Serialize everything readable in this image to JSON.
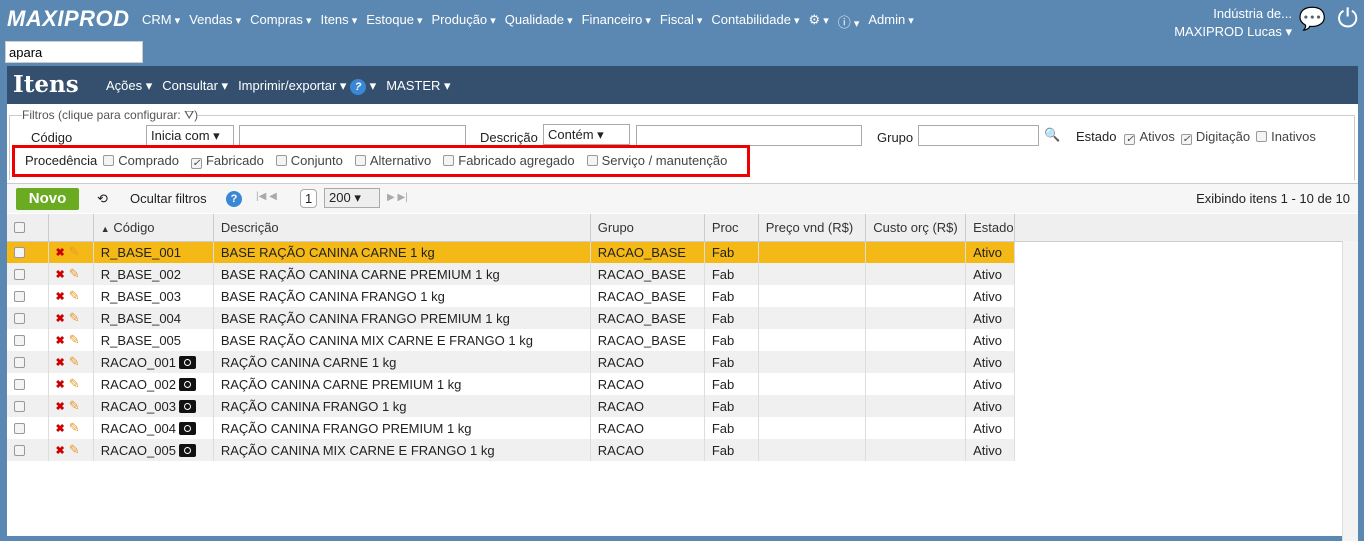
{
  "app": {
    "logo": "MAXIPROD",
    "menu": [
      "CRM",
      "Vendas",
      "Compras",
      "Itens",
      "Estoque",
      "Produção",
      "Qualidade",
      "Financeiro",
      "Fiscal",
      "Contabilidade"
    ],
    "admin": "Admin",
    "search_value": "apara",
    "company": "Indústria de...",
    "user": "MAXIPROD Lucas"
  },
  "page": {
    "title": "Itens",
    "menu": [
      "Ações",
      "Consultar",
      "Imprimir/exportar"
    ],
    "master": "MASTER"
  },
  "filters": {
    "legend": "Filtros (clique para configurar:",
    "codigo_label": "Código",
    "codigo_mode": "Inicia com",
    "descricao_label": "Descrição",
    "descricao_mode": "Contém",
    "grupo_label": "Grupo",
    "estado_label": "Estado",
    "estado": [
      {
        "label": "Ativos",
        "checked": true
      },
      {
        "label": "Digitação",
        "checked": true
      },
      {
        "label": "Inativos",
        "checked": false
      }
    ],
    "procedencia_label": "Procedência",
    "procedencia": [
      {
        "label": "Comprado",
        "checked": false
      },
      {
        "label": "Fabricado",
        "checked": true
      },
      {
        "label": "Conjunto",
        "checked": false
      },
      {
        "label": "Alternativo",
        "checked": false
      },
      {
        "label": "Fabricado agregado",
        "checked": false
      },
      {
        "label": "Serviço / manutenção",
        "checked": false
      }
    ]
  },
  "toolbar": {
    "novo": "Novo",
    "ocultar": "Ocultar filtros",
    "page": "1",
    "page_size": "200",
    "status": "Exibindo itens 1 - 10 de 10"
  },
  "table": {
    "headers": [
      "Código",
      "Descrição",
      "Grupo",
      "Proc",
      "Preço vnd (R$)",
      "Custo orç (R$)",
      "Estado"
    ],
    "rows": [
      {
        "codigo": "R_BASE_001",
        "desc": "BASE RAÇÃO CANINA CARNE 1 kg",
        "grupo": "RACAO_BASE",
        "proc": "Fab",
        "estado": "Ativo",
        "photo": false
      },
      {
        "codigo": "R_BASE_002",
        "desc": "BASE RAÇÃO CANINA CARNE PREMIUM 1 kg",
        "grupo": "RACAO_BASE",
        "proc": "Fab",
        "estado": "Ativo",
        "photo": false
      },
      {
        "codigo": "R_BASE_003",
        "desc": "BASE RAÇÃO CANINA FRANGO 1 kg",
        "grupo": "RACAO_BASE",
        "proc": "Fab",
        "estado": "Ativo",
        "photo": false
      },
      {
        "codigo": "R_BASE_004",
        "desc": "BASE RAÇÃO CANINA FRANGO PREMIUM 1 kg",
        "grupo": "RACAO_BASE",
        "proc": "Fab",
        "estado": "Ativo",
        "photo": false
      },
      {
        "codigo": "R_BASE_005",
        "desc": "BASE RAÇÃO CANINA MIX CARNE E FRANGO 1 kg",
        "grupo": "RACAO_BASE",
        "proc": "Fab",
        "estado": "Ativo",
        "photo": false
      },
      {
        "codigo": "RACAO_001",
        "desc": "RAÇÃO CANINA CARNE 1 kg",
        "grupo": "RACAO",
        "proc": "Fab",
        "estado": "Ativo",
        "photo": true
      },
      {
        "codigo": "RACAO_002",
        "desc": "RAÇÃO CANINA CARNE PREMIUM 1 kg",
        "grupo": "RACAO",
        "proc": "Fab",
        "estado": "Ativo",
        "photo": true
      },
      {
        "codigo": "RACAO_003",
        "desc": "RAÇÃO CANINA FRANGO 1 kg",
        "grupo": "RACAO",
        "proc": "Fab",
        "estado": "Ativo",
        "photo": true
      },
      {
        "codigo": "RACAO_004",
        "desc": "RAÇÃO CANINA FRANGO PREMIUM 1 kg",
        "grupo": "RACAO",
        "proc": "Fab",
        "estado": "Ativo",
        "photo": true
      },
      {
        "codigo": "RACAO_005",
        "desc": "RAÇÃO CANINA MIX CARNE E FRANGO 1 kg",
        "grupo": "RACAO",
        "proc": "Fab",
        "estado": "Ativo",
        "photo": true
      }
    ]
  }
}
